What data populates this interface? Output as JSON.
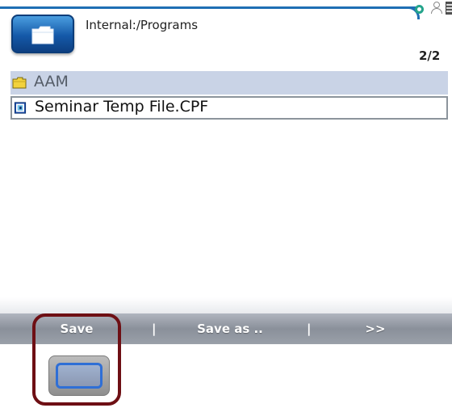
{
  "header": {
    "path": "Internal:/Programs",
    "page_count": "2/2",
    "folder_button_icon": "folder-icon"
  },
  "status_icons": [
    "search-icon",
    "person-icon",
    "battery-icon"
  ],
  "list": {
    "items": [
      {
        "label": "AAM",
        "type": "folder",
        "icon": "folder-icon"
      },
      {
        "label": "Seminar Temp File.CPF",
        "type": "file",
        "icon": "program-file-icon",
        "selected": true
      }
    ]
  },
  "softkeys": {
    "save": "Save",
    "separator": "|",
    "save_as": "Save as ..",
    "more": ">>"
  },
  "colors": {
    "accent": "#1f6fb4",
    "highlight": "#6e0f14",
    "folder_row": "#c9d3e6"
  }
}
